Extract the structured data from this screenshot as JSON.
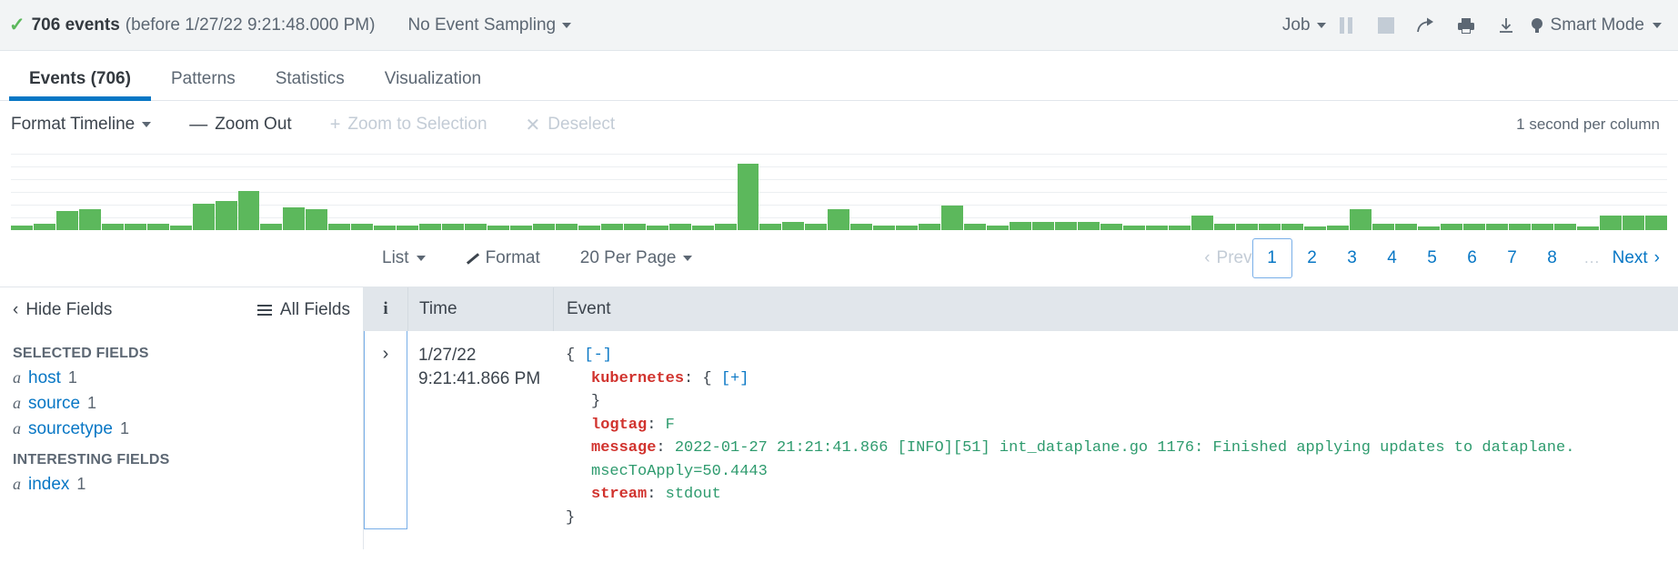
{
  "topbar": {
    "check_icon": "check-icon",
    "event_count": "706 events",
    "event_time_note": "(before 1/27/22 9:21:48.000 PM)",
    "sampling_label": "No Event Sampling",
    "job_label": "Job",
    "pause_icon": "pause-icon",
    "stop_icon": "stop-icon",
    "share_icon": "share-icon",
    "print_icon": "print-icon",
    "export_icon": "download-icon",
    "smart_mode_label": "Smart Mode",
    "bulb_icon": "lightbulb-icon"
  },
  "tabs": [
    {
      "label": "Events (706)",
      "active": true
    },
    {
      "label": "Patterns",
      "active": false
    },
    {
      "label": "Statistics",
      "active": false
    },
    {
      "label": "Visualization",
      "active": false
    }
  ],
  "timeline_toolbar": {
    "format_timeline": "Format Timeline",
    "zoom_out": "Zoom Out",
    "zoom_out_sym": "—",
    "zoom_to_selection": "Zoom to Selection",
    "zoom_to_selection_sym": "+",
    "deselect": "Deselect",
    "deselect_sym": "✕",
    "scale_note": "1 second per column"
  },
  "chart_data": {
    "type": "bar",
    "title": "",
    "xlabel": "",
    "ylabel": "",
    "grid": true,
    "bar_color": "#5cb85c",
    "categories": [],
    "values": [
      3,
      4,
      12,
      13,
      4,
      4,
      4,
      3,
      16,
      18,
      24,
      4,
      14,
      13,
      4,
      4,
      3,
      3,
      4,
      4,
      4,
      3,
      3,
      4,
      4,
      3,
      4,
      4,
      3,
      4,
      3,
      4,
      41,
      4,
      5,
      4,
      13,
      4,
      3,
      3,
      4,
      15,
      4,
      3,
      5,
      5,
      5,
      5,
      4,
      3,
      3,
      3,
      9,
      4,
      4,
      4,
      4,
      2,
      3,
      13,
      4,
      4,
      2,
      4,
      4,
      4,
      4,
      4,
      4,
      2,
      9,
      9,
      9
    ],
    "ylim": [
      0,
      48
    ],
    "legend": []
  },
  "list_controls": {
    "view_mode": "List",
    "format_label": "Format",
    "format_icon": "pencil-icon",
    "per_page": "20 Per Page",
    "prev_label": "Prev",
    "next_label": "Next",
    "pages": [
      "1",
      "2",
      "3",
      "4",
      "5",
      "6",
      "7",
      "8"
    ],
    "ellipsis": "...",
    "current_page": "1"
  },
  "sidebar": {
    "hide_fields": "Hide Fields",
    "all_fields": "All Fields",
    "selected_title": "SELECTED FIELDS",
    "selected_fields": [
      {
        "type": "a",
        "name": "host",
        "count": "1"
      },
      {
        "type": "a",
        "name": "source",
        "count": "1"
      },
      {
        "type": "a",
        "name": "sourcetype",
        "count": "1"
      }
    ],
    "interesting_title": "INTERESTING FIELDS",
    "interesting_fields": [
      {
        "type": "a",
        "name": "index",
        "count": "1"
      }
    ]
  },
  "table": {
    "headers": {
      "info": "i",
      "time": "Time",
      "event": "Event"
    },
    "row": {
      "expand_icon": "chevron-right-icon",
      "date": "1/27/22",
      "time": "9:21:41.866 PM",
      "json_lines": [
        {
          "parts": [
            {
              "t": "{ ",
              "c": "brace"
            },
            {
              "t": "[-]",
              "c": "tog"
            }
          ],
          "indent": 0
        },
        {
          "parts": [
            {
              "t": "kubernetes",
              "c": "key"
            },
            {
              "t": ": { ",
              "c": "brace"
            },
            {
              "t": "[+]",
              "c": "tog"
            }
          ],
          "indent": 1
        },
        {
          "parts": [
            {
              "t": "}",
              "c": "brace"
            }
          ],
          "indent": 1
        },
        {
          "parts": [
            {
              "t": "logtag",
              "c": "key"
            },
            {
              "t": ": ",
              "c": "brace"
            },
            {
              "t": "F",
              "c": "val"
            }
          ],
          "indent": 1
        },
        {
          "parts": [
            {
              "t": "message",
              "c": "key"
            },
            {
              "t": ": ",
              "c": "brace"
            },
            {
              "t": "2022-01-27 21:21:41.866 [INFO][51] int_dataplane.go 1176: Finished applying updates to dataplane. msecToApply=50.4443",
              "c": "val"
            }
          ],
          "indent": 1
        },
        {
          "parts": [
            {
              "t": "stream",
              "c": "key"
            },
            {
              "t": ": ",
              "c": "brace"
            },
            {
              "t": "stdout",
              "c": "val"
            }
          ],
          "indent": 1
        },
        {
          "parts": [
            {
              "t": "}",
              "c": "brace"
            }
          ],
          "indent": 0
        }
      ]
    }
  },
  "colors": {
    "accent": "#0877c5",
    "bar_green": "#5cb85c",
    "key_red": "#d1332e",
    "value_green": "#2e9b6e",
    "header_bg": "#e1e6eb"
  }
}
